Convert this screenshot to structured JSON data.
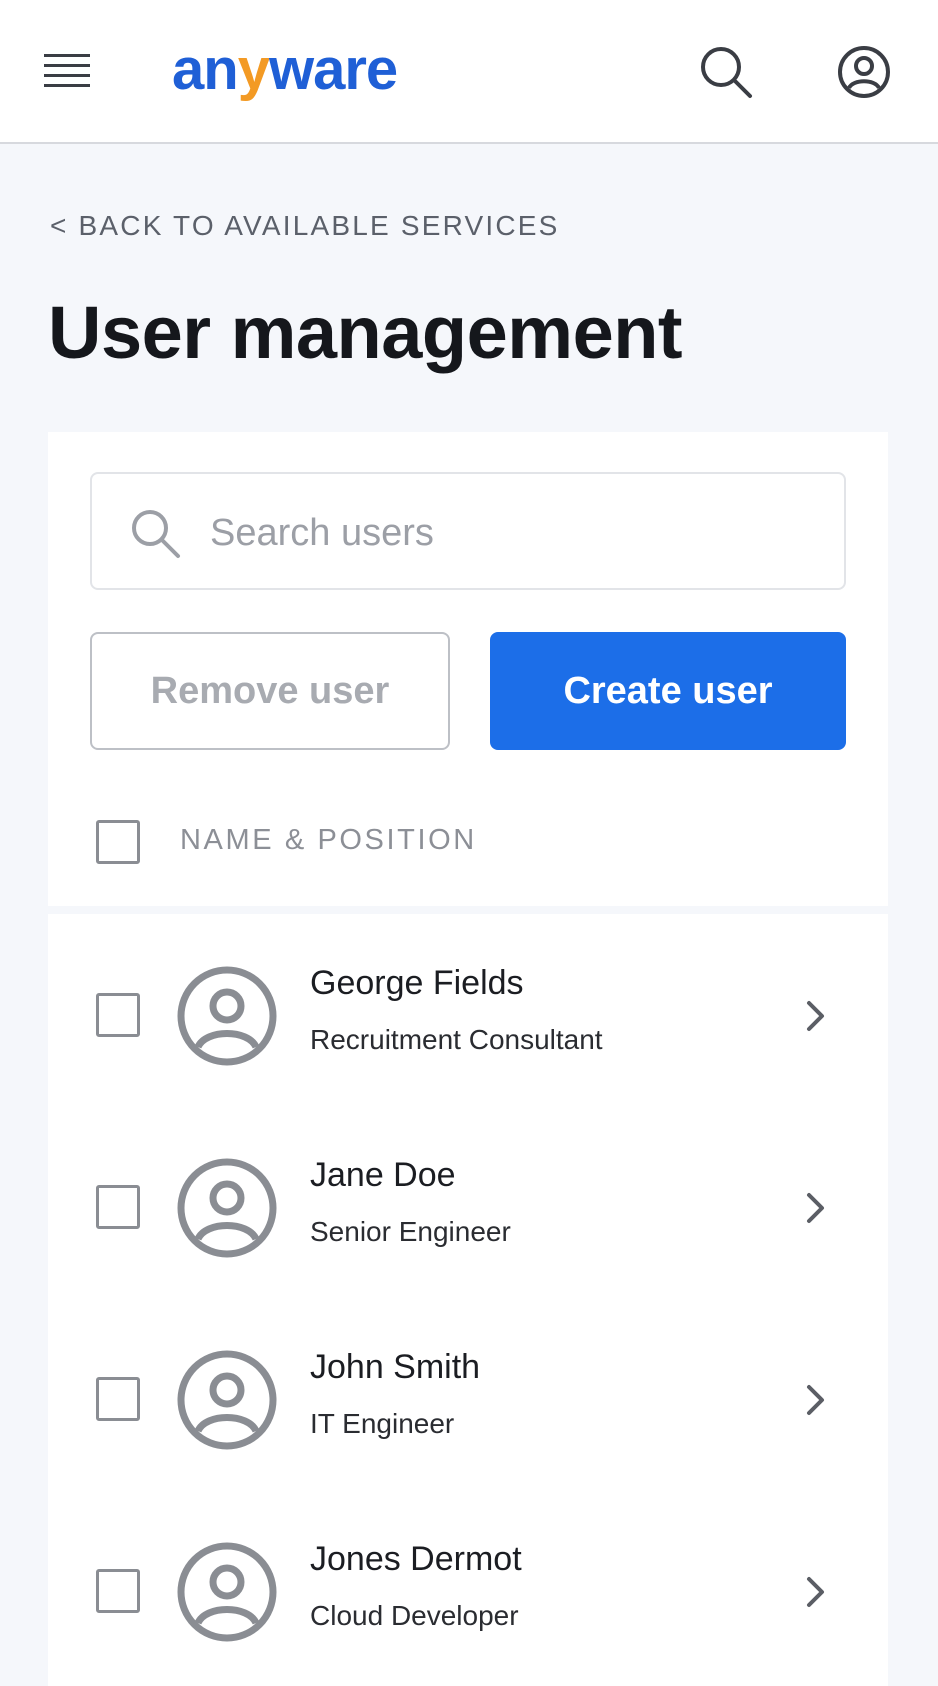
{
  "header": {
    "brand_prefix": "an",
    "brand_accent": "y",
    "brand_suffix": "ware",
    "colors": {
      "brand": "#1f5fd6",
      "accent": "#f39a24"
    },
    "icons": [
      "hamburger-menu-icon",
      "search-icon",
      "user-account-icon"
    ]
  },
  "nav": {
    "back_label": "< BACK TO AVAILABLE SERVICES"
  },
  "page": {
    "title": "User management"
  },
  "search": {
    "placeholder": "Search users",
    "value": ""
  },
  "actions": {
    "remove_label": "Remove user",
    "create_label": "Create user",
    "primary_color": "#1c6ee8"
  },
  "table": {
    "column_header": "NAME & POSITION",
    "select_all_checked": false,
    "users": [
      {
        "name": "George Fields",
        "position": "Recruitment Consultant",
        "checked": false
      },
      {
        "name": "Jane Doe",
        "position": "Senior Engineer",
        "checked": false
      },
      {
        "name": "John Smith",
        "position": "IT Engineer",
        "checked": false
      },
      {
        "name": "Jones Dermot",
        "position": "Cloud Developer",
        "checked": false
      }
    ]
  }
}
